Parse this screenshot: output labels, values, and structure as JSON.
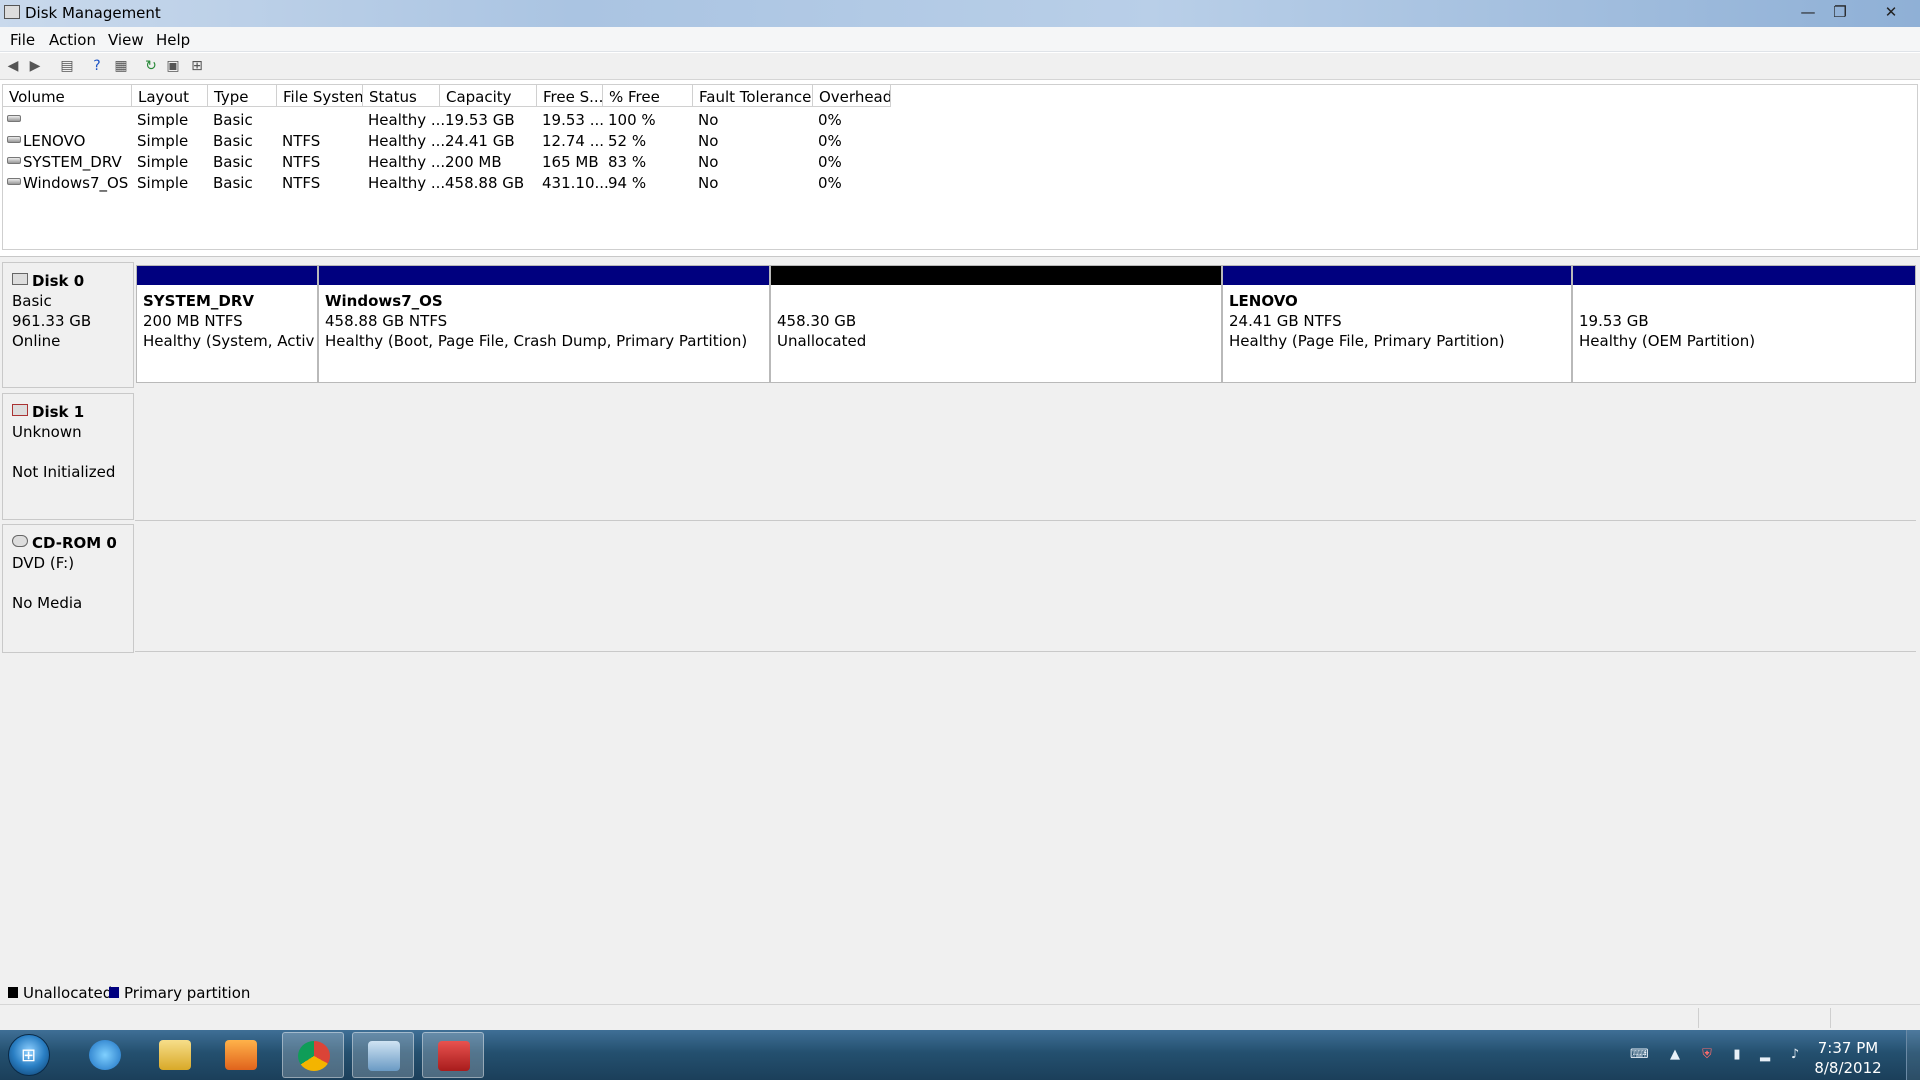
{
  "window": {
    "title": "Disk Management",
    "controls": {
      "minimize": "—",
      "maximize": "❐",
      "close": "✕"
    }
  },
  "menu": {
    "file": "File",
    "action": "Action",
    "view": "View",
    "help": "Help"
  },
  "toolbar": {
    "icons": [
      "back-arrow-icon",
      "forward-arrow-icon",
      "console-tree-icon",
      "help-icon",
      "show-hide-icon",
      "refresh-icon",
      "properties-icon",
      "rescan-icon"
    ]
  },
  "volume_list": {
    "columns": [
      "Volume",
      "Layout",
      "Type",
      "File System",
      "Status",
      "Capacity",
      "Free S...",
      "% Free",
      "Fault Tolerance",
      "Overhead"
    ],
    "rows": [
      {
        "volume": "",
        "layout": "Simple",
        "type": "Basic",
        "fs": "",
        "status": "Healthy ...",
        "capacity": "19.53 GB",
        "free": "19.53 ...",
        "pct": "100 %",
        "fault": "No",
        "overhead": "0%"
      },
      {
        "volume": "LENOVO",
        "layout": "Simple",
        "type": "Basic",
        "fs": "NTFS",
        "status": "Healthy ...",
        "capacity": "24.41 GB",
        "free": "12.74 ...",
        "pct": "52 %",
        "fault": "No",
        "overhead": "0%"
      },
      {
        "volume": "SYSTEM_DRV",
        "layout": "Simple",
        "type": "Basic",
        "fs": "NTFS",
        "status": "Healthy ...",
        "capacity": "200 MB",
        "free": "165 MB",
        "pct": "83 %",
        "fault": "No",
        "overhead": "0%"
      },
      {
        "volume": "Windows7_OS",
        "layout": "Simple",
        "type": "Basic",
        "fs": "NTFS",
        "status": "Healthy ...",
        "capacity": "458.88 GB",
        "free": "431.10...",
        "pct": "94 %",
        "fault": "No",
        "overhead": "0%"
      }
    ]
  },
  "disks": {
    "disk0": {
      "name": "Disk 0",
      "type": "Basic",
      "size": "961.33 GB",
      "state": "Online"
    },
    "disk1": {
      "name": "Disk 1",
      "type": "Unknown",
      "state": "Not Initialized"
    },
    "cdrom0": {
      "name": "CD-ROM 0",
      "type": "DVD (F:)",
      "state": "No Media"
    }
  },
  "partitions": [
    {
      "name": "SYSTEM_DRV",
      "size": "200 MB NTFS",
      "status": "Healthy (System, Active, P",
      "kind": "primary"
    },
    {
      "name": "Windows7_OS",
      "size": "458.88 GB NTFS",
      "status": "Healthy (Boot, Page File, Crash Dump, Primary Partition)",
      "kind": "primary"
    },
    {
      "name": "",
      "size": "458.30 GB",
      "status": "Unallocated",
      "kind": "unallocated"
    },
    {
      "name": "LENOVO",
      "size": "24.41 GB NTFS",
      "status": "Healthy (Page File, Primary Partition)",
      "kind": "primary"
    },
    {
      "name": "",
      "size": "19.53 GB",
      "status": "Healthy (OEM Partition)",
      "kind": "primary"
    }
  ],
  "legend": {
    "unallocated": "Unallocated",
    "primary": "Primary partition"
  },
  "colors": {
    "primary": "#00007f",
    "unallocated": "#000000"
  },
  "taskbar": {
    "apps": [
      "internet-explorer-icon",
      "file-explorer-icon",
      "media-player-icon",
      "chrome-icon",
      "computer-management-icon",
      "toolbox-icon"
    ],
    "clock_time": "7:37 PM",
    "clock_date": "8/8/2012"
  }
}
